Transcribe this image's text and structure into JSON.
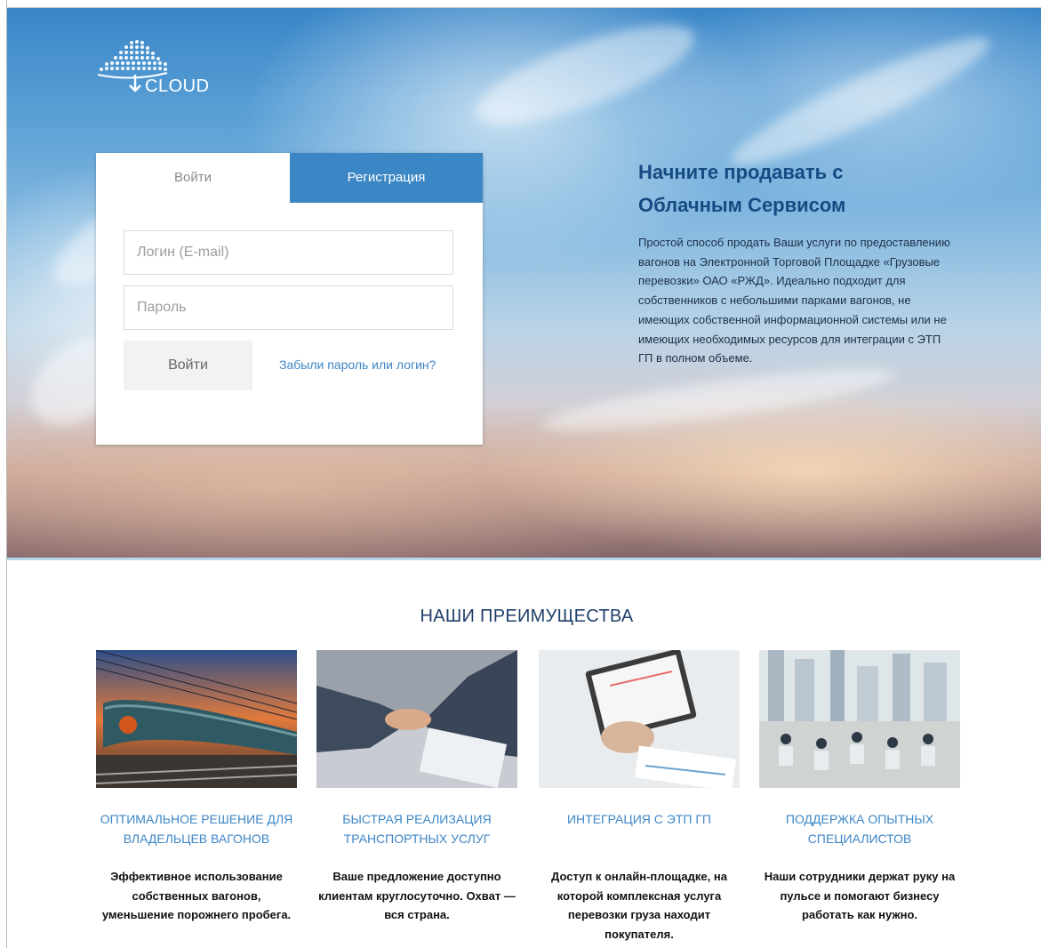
{
  "brand": {
    "logo_text": "CLOUD",
    "icon": "cloud-globe-icon"
  },
  "login_form": {
    "tab_login": "Войти",
    "tab_register": "Регистрация",
    "login_placeholder": "Логин (E-mail)",
    "login_value": "",
    "password_placeholder": "Пароль",
    "password_value": "",
    "submit_label": "Войти",
    "forgot_link": "Забыли пароль или логин?"
  },
  "hero": {
    "title": "Начните продавать с Облачным Сервисом",
    "description": "Простой способ продать Ваши услуги по предоставлению вагонов на Электронной Торговой Площадке «Грузовые перевозки» ОАО «РЖД». Идеально подходит для собственников с небольшими парками вагонов, не имеющих собственной информационной системы или не имеющих необходимых ресурсов для интеграции с ЭТП ГП в полном объеме."
  },
  "advantages": {
    "title": "НАШИ ПРЕИМУЩЕСТВА",
    "items": [
      {
        "title": "ОПТИМАЛЬНОЕ РЕШЕНИЕ ДЛЯ ВЛАДЕЛЬЦЕВ ВАГОНОВ",
        "desc": "Эффективное использование собственных вагонов, уменьшение порожнего пробега.",
        "image": "tank-train-photo"
      },
      {
        "title": "БЫСТРАЯ РЕАЛИЗАЦИЯ ТРАНСПОРТНЫХ УСЛУГ",
        "desc": "Ваше предложение доступно клиентам круглосуточно. Охват — вся страна.",
        "image": "handshake-photo"
      },
      {
        "title": "ИНТЕГРАЦИЯ С ЭТП ГП",
        "desc": "Доступ к онлайн-площадке, на которой комплексная услуга перевозки груза находит покупателя.",
        "image": "tablet-analytics-photo"
      },
      {
        "title": "ПОДДЕРЖКА ОПЫТНЫХ СПЕЦИАЛИСТОВ",
        "desc": "Наши сотрудники держат руку на пульсе и помогают бизнесу работать как нужно.",
        "image": "office-team-photo"
      }
    ]
  },
  "colors": {
    "accent": "#3b86c4",
    "title": "#154b82",
    "link": "#3d86c6"
  }
}
